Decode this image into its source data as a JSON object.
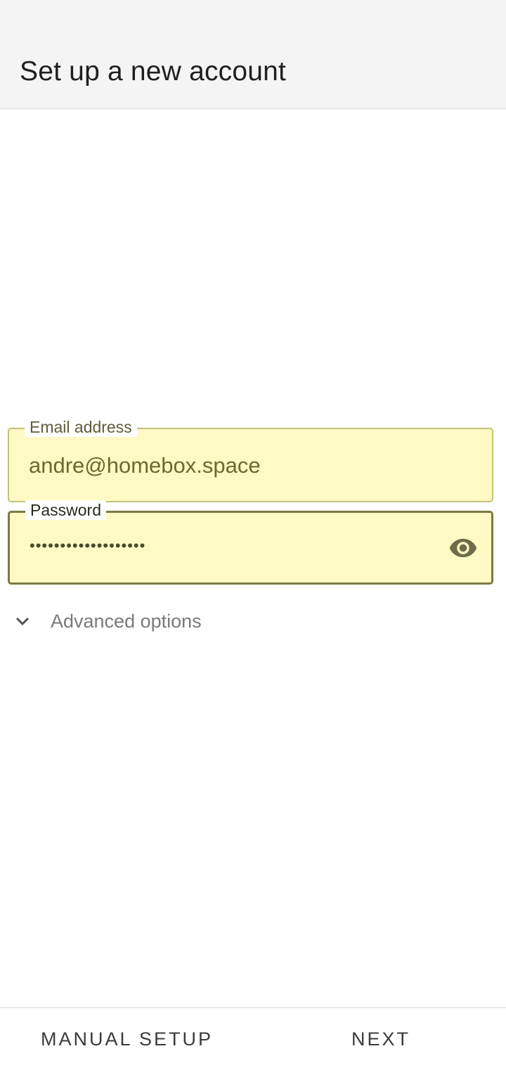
{
  "app_bar": {
    "title": "Set up a new account"
  },
  "form": {
    "email": {
      "label": "Email address",
      "value": "andre@homebox.space"
    },
    "password": {
      "label": "Password",
      "masked_value": "•••••••••••••••••••",
      "toggle_icon": "eye-icon"
    },
    "advanced_options": {
      "label": "Advanced options",
      "icon": "chevron-down-icon"
    }
  },
  "footer": {
    "manual_setup_label": "MANUAL SETUP",
    "next_label": "NEXT"
  },
  "colors": {
    "field_fill": "#fff9c4",
    "field_border_focused": "#7b7a44",
    "app_bar_bg": "#f4f4f4"
  }
}
